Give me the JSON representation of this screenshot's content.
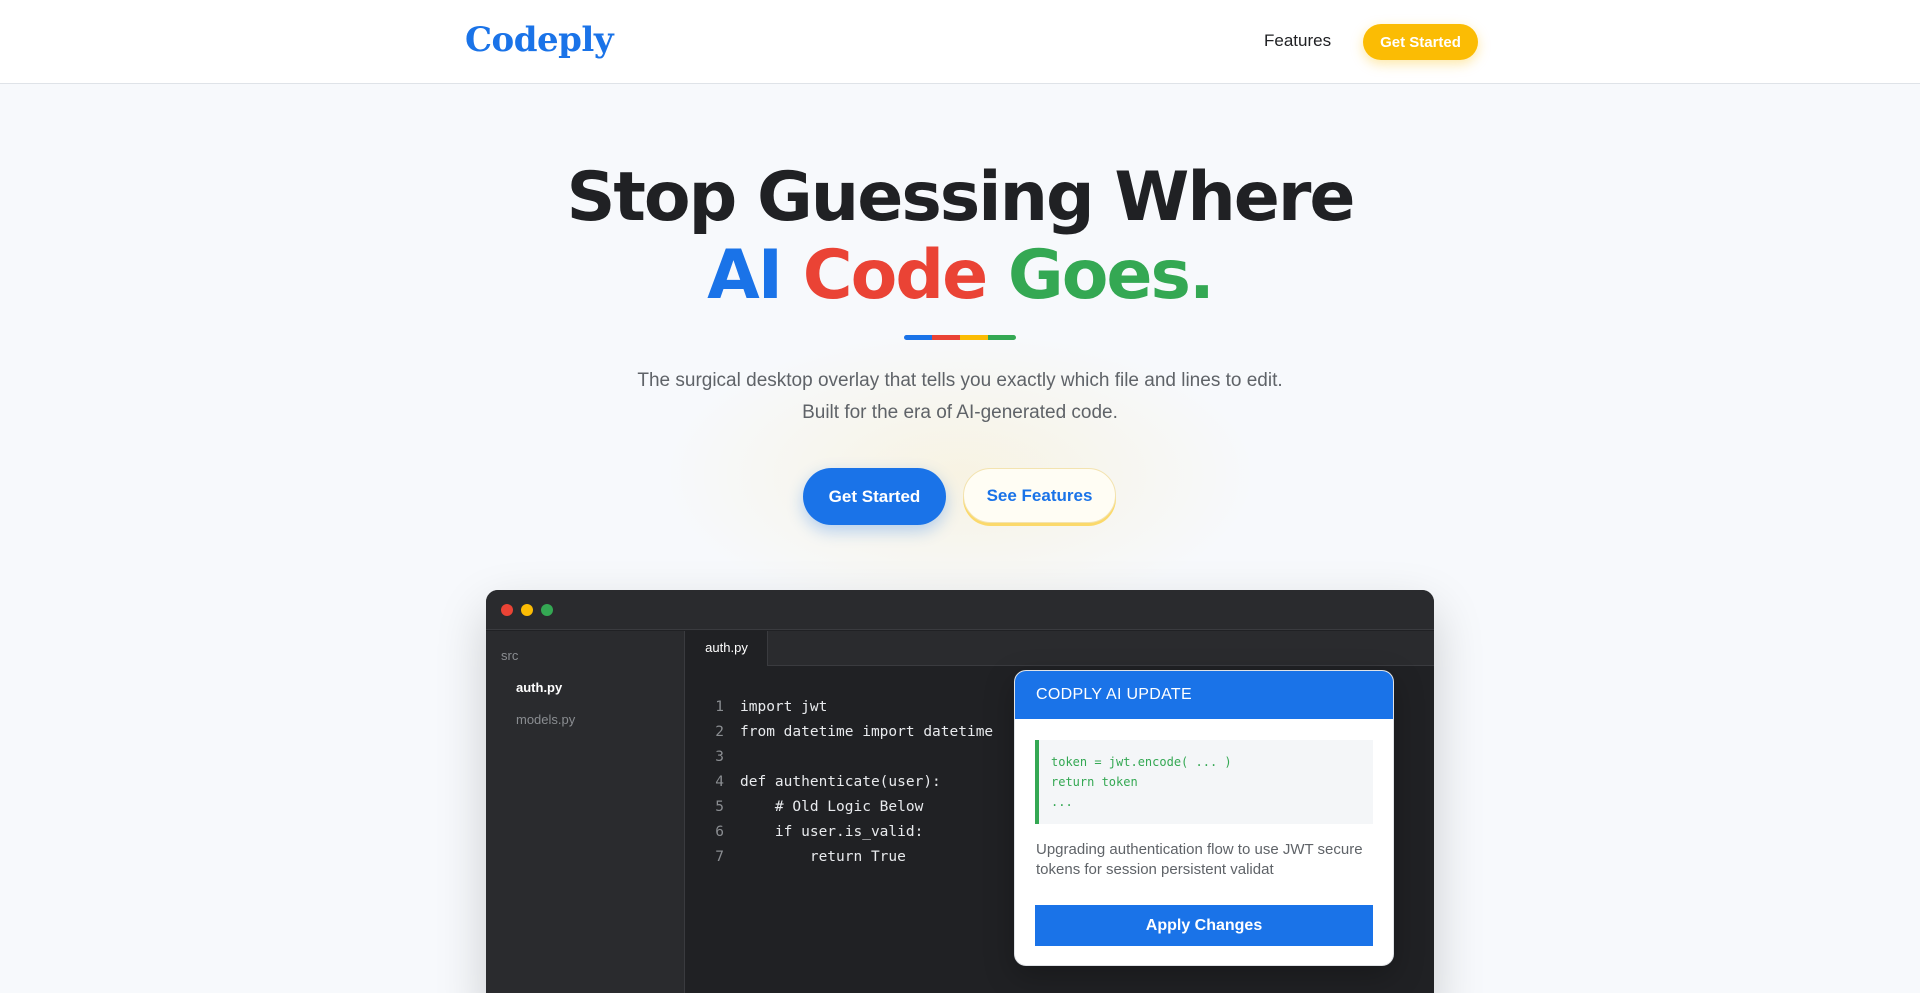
{
  "nav": {
    "logo": "Codeply",
    "features_link": "Features",
    "cta_label": "Get Started"
  },
  "hero": {
    "headline_line1": "Stop Guessing Where",
    "headline_word_ai": "AI",
    "headline_word_code": "Code",
    "headline_word_goes": "Goes.",
    "subtitle_line1": "The surgical desktop overlay that tells you exactly which file and lines to edit.",
    "subtitle_line2": "Built for the era of AI-generated code.",
    "primary_button": "Get Started",
    "secondary_button": "See Features",
    "accent_colors": [
      "#1a73e8",
      "#ea4335",
      "#fbbc04",
      "#34a853"
    ]
  },
  "editor": {
    "window_controls": [
      "close-dot",
      "minimize-dot",
      "maximize-dot"
    ],
    "sidebar": {
      "folder": "src",
      "files": [
        "auth.py",
        "models.py"
      ],
      "active_file": "auth.py"
    },
    "active_tab": "auth.py",
    "code_lines": [
      {
        "num": "1",
        "text": "import jwt"
      },
      {
        "num": "2",
        "text": "from datetime import datetime"
      },
      {
        "num": "3",
        "text": ""
      },
      {
        "num": "4",
        "text": "def authenticate(user):"
      },
      {
        "num": "5",
        "text": "    # Old Logic Below"
      },
      {
        "num": "6",
        "text": "    if user.is_valid:"
      },
      {
        "num": "7",
        "text": "        return True"
      }
    ]
  },
  "popup": {
    "header": "CODPLY AI UPDATE",
    "diff_lines": [
      "token = jwt.encode( ... )",
      "return token",
      "..."
    ],
    "description": "Upgrading authentication flow to use JWT secure tokens for session persistent validat",
    "apply_button": "Apply Changes"
  },
  "colors": {
    "brand_blue": "#1a73e8",
    "brand_red": "#ea4335",
    "brand_yellow": "#fbbc04",
    "brand_green": "#34a853",
    "editor_bg": "#202124"
  }
}
